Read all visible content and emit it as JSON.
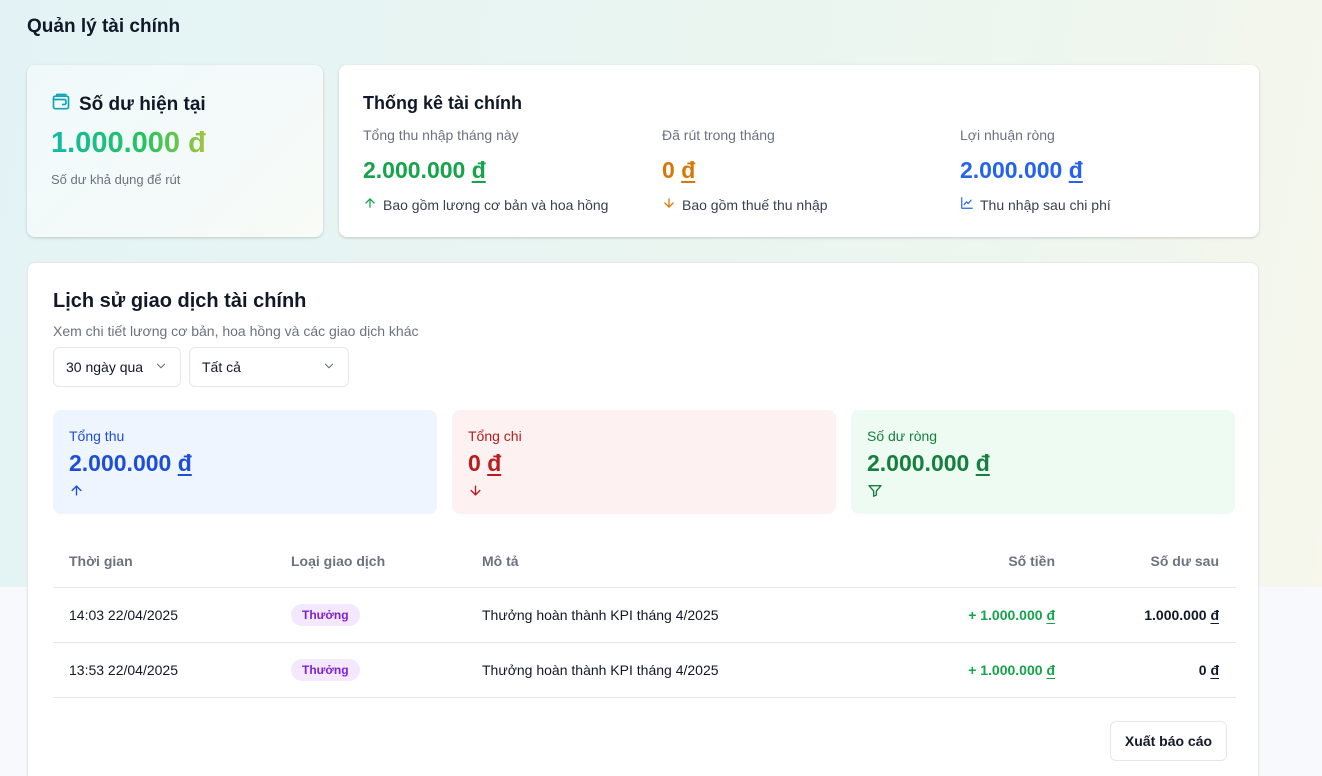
{
  "page": {
    "title": "Quản lý tài chính"
  },
  "balance": {
    "label": "Số dư hiện tại",
    "amount": "1.000.000",
    "currency": "đ",
    "note": "Số dư khả dụng để rút"
  },
  "stats": {
    "title": "Thống kê tài chính",
    "items": [
      {
        "label": "Tổng thu nhập tháng này",
        "amount": "2.000.000",
        "currency": "đ",
        "note": "Bao gồm lương cơ bản và hoa hồng",
        "color": "#16a34a",
        "icon": "arrow-up-icon"
      },
      {
        "label": "Đã rút trong tháng",
        "amount": "0",
        "currency": "đ",
        "note": "Bao gồm thuế thu nhập",
        "color": "#d97706",
        "icon": "arrow-down-icon"
      },
      {
        "label": "Lợi nhuận ròng",
        "amount": "2.000.000",
        "currency": "đ",
        "note": "Thu nhập sau chi phí",
        "color": "#2563eb",
        "icon": "chart-line-icon"
      }
    ]
  },
  "history": {
    "title": "Lịch sử giao dịch tài chính",
    "subtitle": "Xem chi tiết lương cơ bản, hoa hồng và các giao dịch khác",
    "filters": {
      "period": "30 ngày qua",
      "type": "Tất cả"
    },
    "summary": [
      {
        "label": "Tổng thu",
        "amount": "2.000.000",
        "currency": "đ",
        "icon": "arrow-up-icon",
        "color": "#1d4ed8",
        "bg": "#eef5ff"
      },
      {
        "label": "Tổng chi",
        "amount": "0",
        "currency": "đ",
        "icon": "arrow-down-icon",
        "color": "#b91c1c",
        "bg": "#fef1f1"
      },
      {
        "label": "Số dư ròng",
        "amount": "2.000.000",
        "currency": "đ",
        "icon": "filter-icon",
        "color": "#15803d",
        "bg": "#edfbf2"
      }
    ],
    "columns": [
      "Thời gian",
      "Loại giao dịch",
      "Mô tả",
      "Số tiền",
      "Số dư sau"
    ],
    "rows": [
      {
        "time": "14:03 22/04/2025",
        "type": "Thưởng",
        "desc": "Thưởng hoàn thành KPI tháng 4/2025",
        "amount": "+ 1.000.000",
        "currency": "đ",
        "balance": "1.000.000"
      },
      {
        "time": "13:53 22/04/2025",
        "type": "Thưởng",
        "desc": "Thưởng hoàn thành KPI tháng 4/2025",
        "amount": "+ 1.000.000",
        "currency": "đ",
        "balance": "0"
      }
    ],
    "export_label": "Xuất báo cáo"
  }
}
